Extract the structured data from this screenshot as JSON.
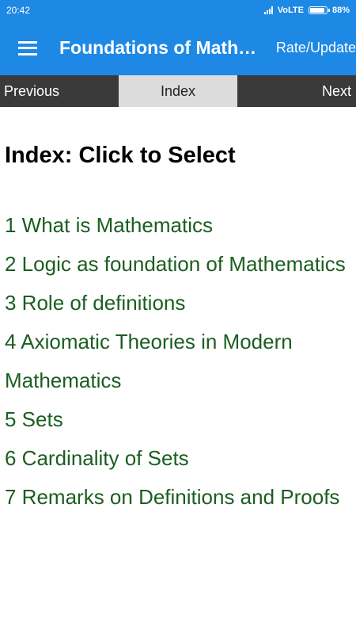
{
  "status_bar": {
    "time": "20:42",
    "network": "VoLTE",
    "battery": "88%",
    "battery_level": 0.88
  },
  "app_bar": {
    "menu_icon": "hamburger-menu-icon",
    "title": "Foundations of Mathematics",
    "rate_label": "Rate/Update"
  },
  "nav": {
    "previous_label": "Previous",
    "index_label": "Index",
    "next_label": "Next"
  },
  "content": {
    "heading": "Index: Click to Select",
    "items": [
      {
        "label": "1 What is Mathematics"
      },
      {
        "label": "2 Logic as foundation of Mathematics"
      },
      {
        "label": "3 Role of definitions"
      },
      {
        "label": "4 Axiomatic Theories in Modern Mathematics"
      },
      {
        "label": "5 Sets"
      },
      {
        "label": "6 Cardinality of Sets"
      },
      {
        "label": "7 Remarks on Definitions and Proofs"
      }
    ]
  },
  "colors": {
    "app_bar": "#1e88e5",
    "nav_dark": "#3a3a3a",
    "nav_active": "#dcdcdc",
    "link_green": "#1b5e20"
  }
}
